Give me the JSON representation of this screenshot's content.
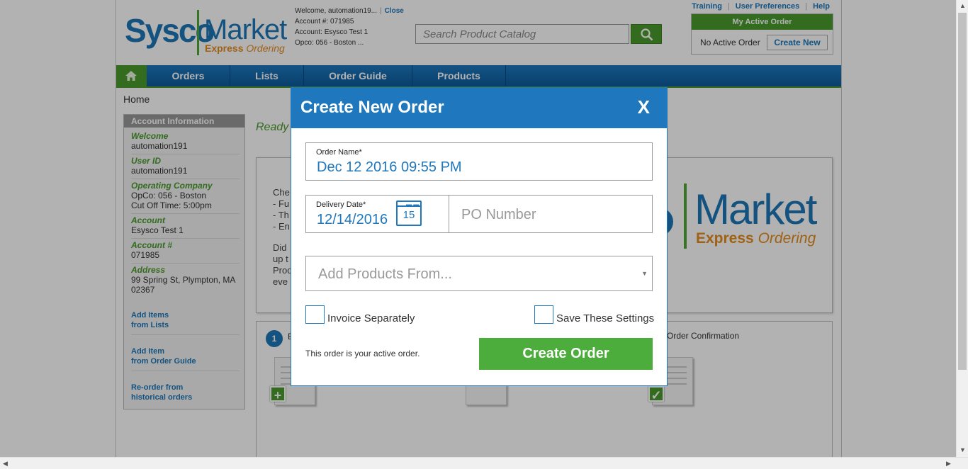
{
  "header": {
    "logo_sysco": "Sysco",
    "logo_market": "Market",
    "logo_express": "Express",
    "logo_ordering": "Ordering",
    "welcome": "Welcome, automation19...",
    "close_link": "Close",
    "account_num": "Account #: 071985",
    "account_name": "Account: Esysco Test 1",
    "opco": "Opco: 056 - Boston ..."
  },
  "search": {
    "placeholder": "Search Product Catalog"
  },
  "top_links": [
    "Training",
    "User Preferences",
    "Help"
  ],
  "active_order": {
    "title": "My Active Order",
    "status": "No Active Order",
    "create_new": "Create New"
  },
  "nav": {
    "items": [
      "Orders",
      "Lists",
      "Order Guide",
      "Products"
    ]
  },
  "breadcrumb": "Home",
  "sidebar": {
    "title": "Account Information",
    "welcome_label": "Welcome",
    "welcome_value": "automation191",
    "userid_label": "User ID",
    "userid_value": "automation191",
    "opco_label": "Operating Company",
    "opco_value": "OpCo: 056 - Boston",
    "cutoff_value": "Cut Off Time: 5:00pm",
    "account_label": "Account",
    "account_value": "Esysco Test 1",
    "accountnum_label": "Account #",
    "accountnum_value": "071985",
    "address_label": "Address",
    "address_line1": "99 Spring St, Plympton, MA",
    "address_line2": "02367",
    "link1_line1": "Add Items",
    "link1_line2": "from Lists",
    "link2_line1": "Add Item",
    "link2_line2": "from Order Guide",
    "link3_line1": "Re-order from",
    "link3_line2": "historical orders"
  },
  "main": {
    "ready": "Ready",
    "panel_lines": [
      "Che",
      "- Fu",
      "- Th",
      "- En",
      "Did",
      "up t",
      "Prod",
      "eve"
    ],
    "step1_num": "1",
    "step1_letter": "E",
    "order_confirmation": "Order Confirmation",
    "big_market": "Market",
    "big_express": "Express",
    "big_ordering": "Ordering"
  },
  "modal": {
    "title": "Create New Order",
    "close": "X",
    "order_name_label": "Order Name*",
    "order_name_value": "Dec 12 2016 09:55 PM",
    "delivery_label": "Delivery Date*",
    "delivery_value": "12/14/2016",
    "calendar_day": "15",
    "po_placeholder": "PO Number",
    "add_products_placeholder": "Add Products From...",
    "invoice_label": "Invoice Separately",
    "save_label": "Save These Settings",
    "active_note": "This order is your active order.",
    "create_button": "Create Order"
  },
  "colors": {
    "brand_blue": "#1f78bd",
    "brand_green": "#4cad3c",
    "brand_orange": "#e58b1b"
  }
}
